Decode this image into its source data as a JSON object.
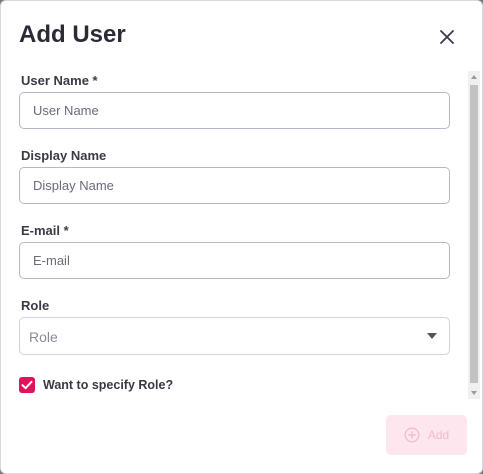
{
  "dialog": {
    "title": "Add User",
    "close_icon": "close-icon"
  },
  "form": {
    "user_name": {
      "label": "User Name *",
      "placeholder": "User Name",
      "value": ""
    },
    "display_name": {
      "label": "Display Name",
      "placeholder": "Display Name",
      "value": ""
    },
    "email": {
      "label": "E-mail *",
      "placeholder": "E-mail",
      "value": ""
    },
    "role": {
      "label": "Role",
      "selected": "Role",
      "icon": "chevron-down-icon"
    },
    "specify_role": {
      "label": "Want to specify Role?",
      "checked": true
    }
  },
  "actions": {
    "add_label": "Add",
    "add_icon": "plus-circle-icon"
  },
  "colors": {
    "accent": "#e0115f",
    "accent_disabled_bg": "#fde6ee",
    "accent_disabled_text": "#f7b9cf"
  }
}
